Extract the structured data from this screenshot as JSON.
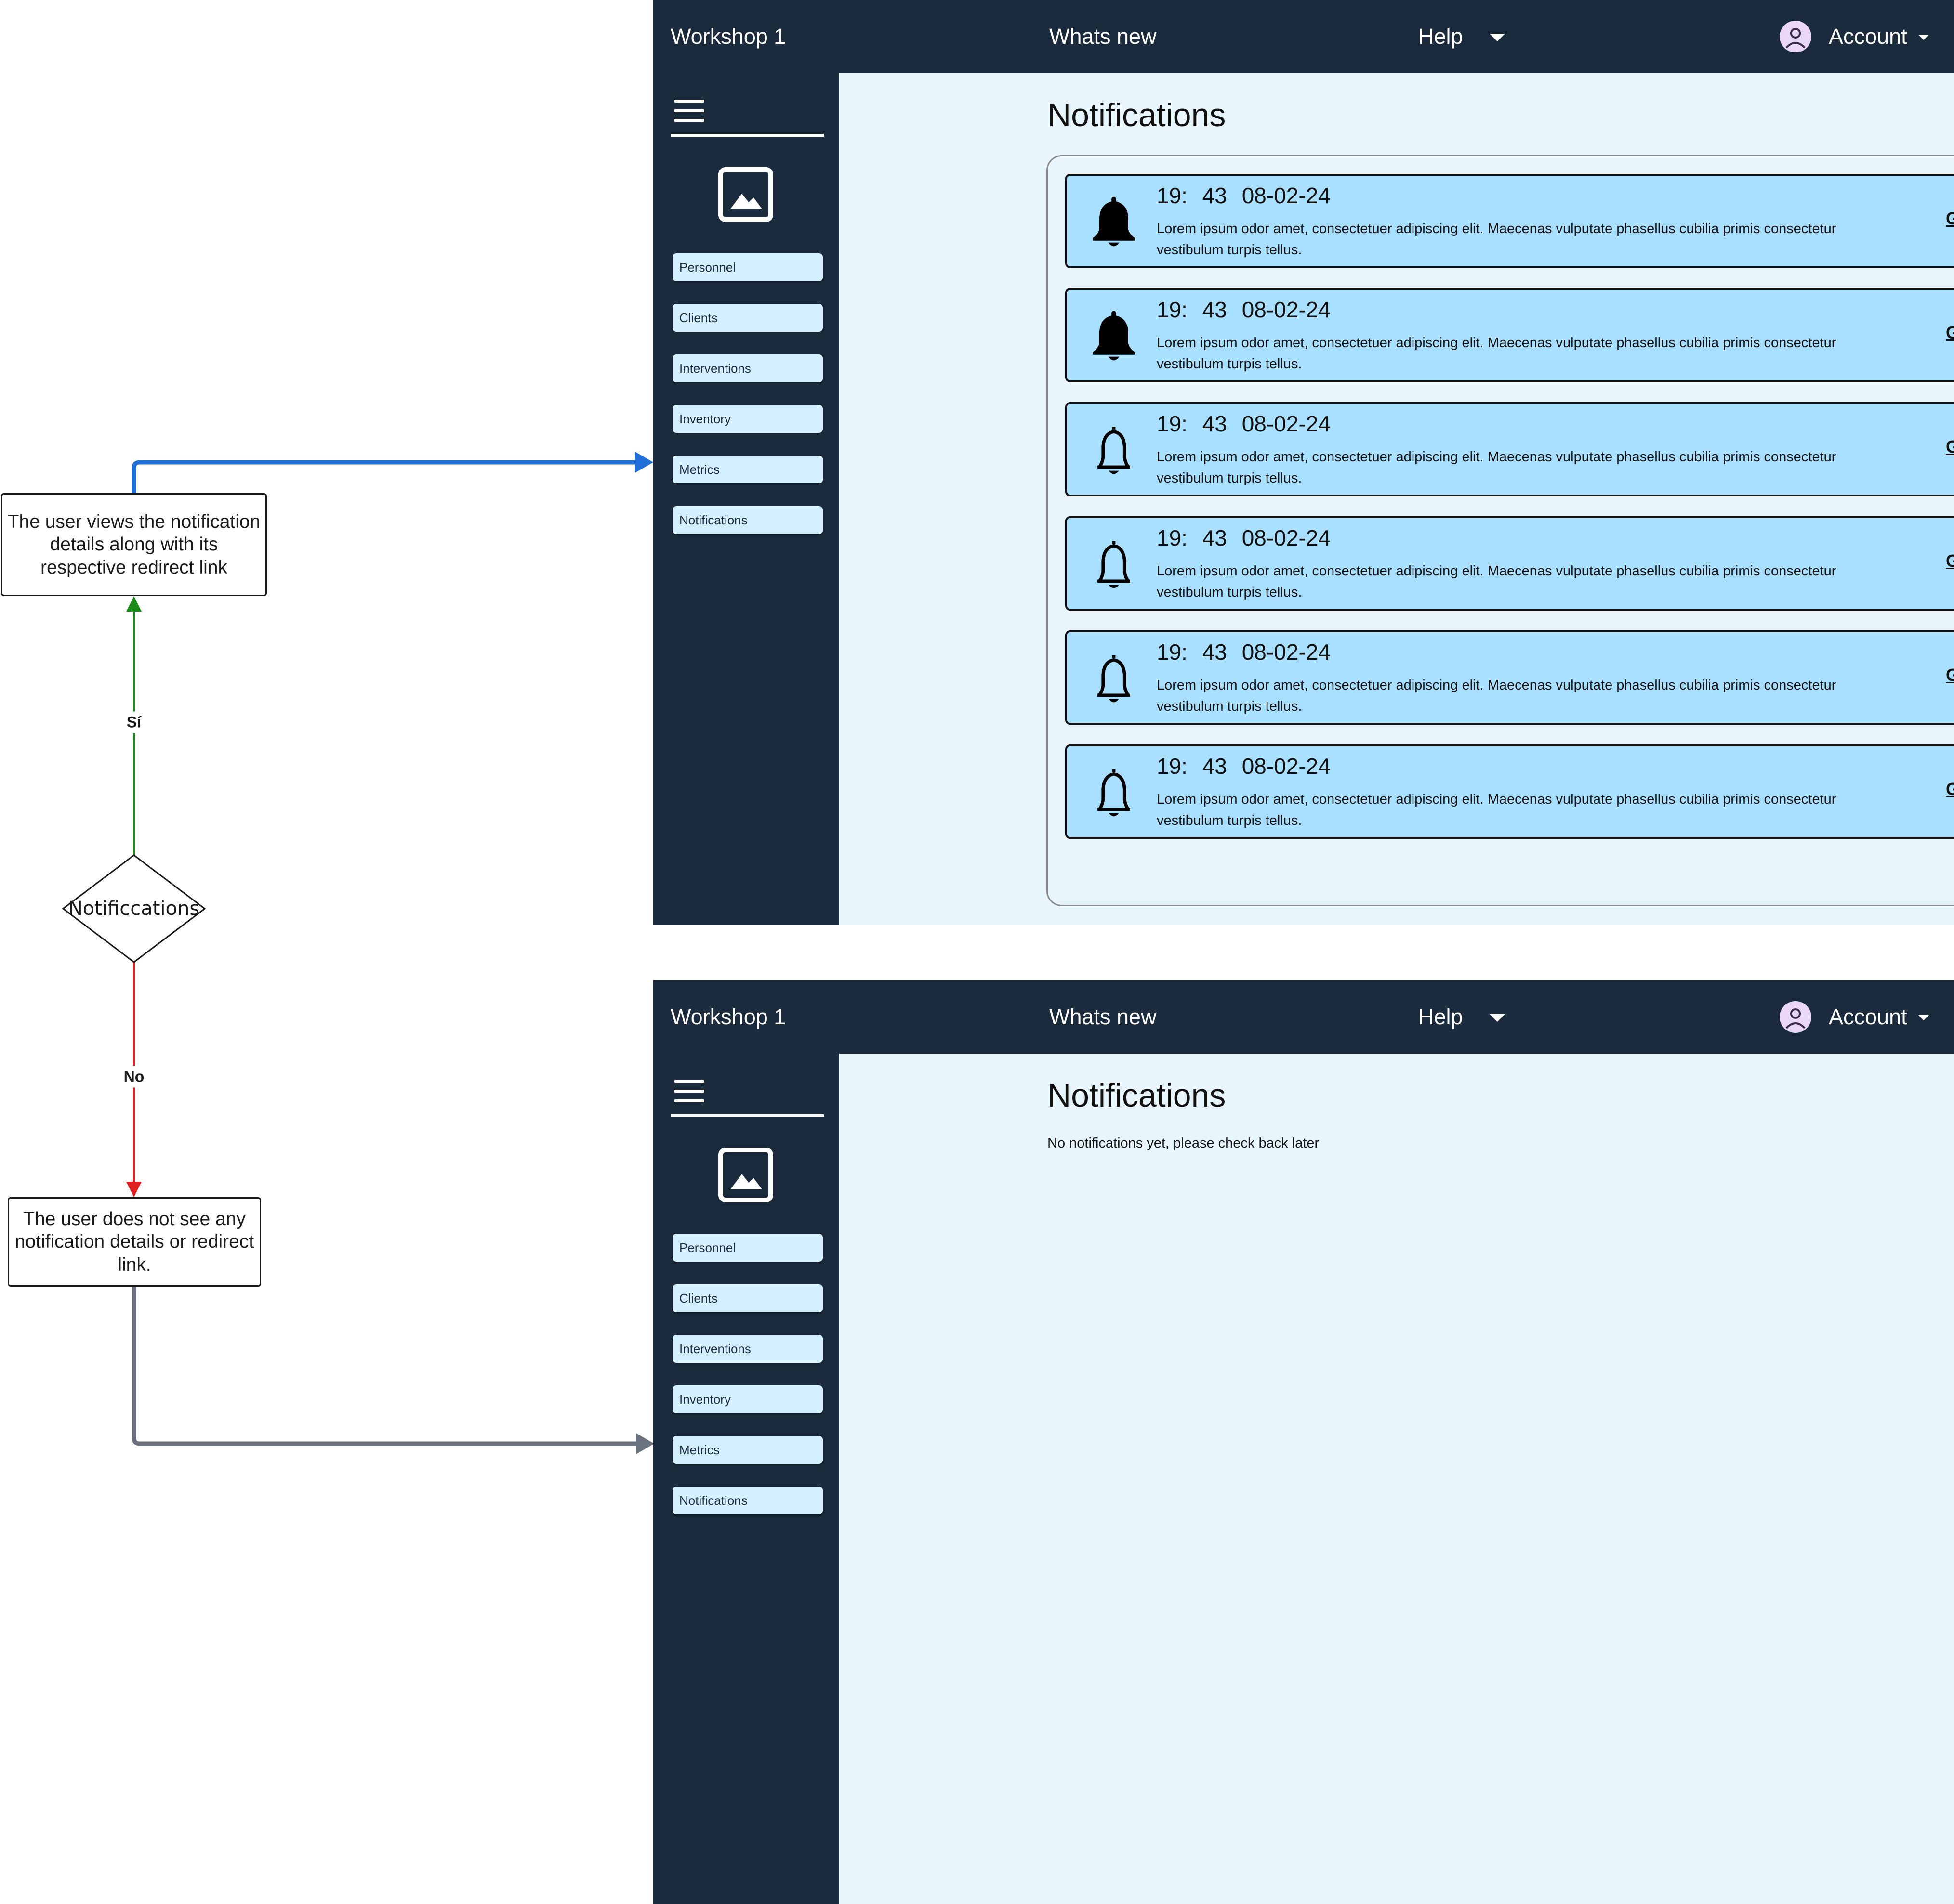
{
  "flowchart": {
    "decision": "Notificcations",
    "yes_label": "Sí",
    "no_label": "No",
    "yes_result": "The user views the notification details along with its respective redirect link",
    "no_result": "The user does not see any notification details or redirect link.",
    "colors": {
      "yes": "#1a8a1a",
      "no": "#e02020",
      "to_screen_yes": "#1f6fd6",
      "to_screen_no": "#6b7380"
    }
  },
  "screen_with_notifications": {
    "topbar": {
      "title": "Workshop 1",
      "whats_new": "Whats new",
      "help": "Help",
      "account": "Account"
    },
    "sidebar": {
      "items": [
        "Personnel",
        "Clients",
        "Interventions",
        "Inventory",
        "Metrics",
        "Notifications"
      ]
    },
    "page_title": "Notifications",
    "notifications": [
      {
        "time": "19: 43",
        "date": "08-02-24",
        "bell": "filled",
        "body": "Lorem ipsum odor amet, consectetuer adipiscing elit. Maecenas vulputate phasellus cubilia primis consectetur vestibulum turpis tellus.",
        "link": "Go to the section"
      },
      {
        "time": "19: 43",
        "date": "08-02-24",
        "bell": "filled",
        "body": "Lorem ipsum odor amet, consectetuer adipiscing elit. Maecenas vulputate phasellus cubilia primis consectetur vestibulum turpis tellus.",
        "link": "Go to the section"
      },
      {
        "time": "19: 43",
        "date": "08-02-24",
        "bell": "outline",
        "body": "Lorem ipsum odor amet, consectetuer adipiscing elit. Maecenas vulputate phasellus cubilia primis consectetur vestibulum turpis tellus.",
        "link": "Go to the section"
      },
      {
        "time": "19: 43",
        "date": "08-02-24",
        "bell": "outline",
        "body": "Lorem ipsum odor amet, consectetuer adipiscing elit. Maecenas vulputate phasellus cubilia primis consectetur vestibulum turpis tellus.",
        "link": "Go to the section"
      },
      {
        "time": "19: 43",
        "date": "08-02-24",
        "bell": "outline",
        "body": "Lorem ipsum odor amet, consectetuer adipiscing elit. Maecenas vulputate phasellus cubilia primis consectetur vestibulum turpis tellus.",
        "link": "Go to the section"
      },
      {
        "time": "19: 43",
        "date": "08-02-24",
        "bell": "outline",
        "body": "Lorem ipsum odor amet, consectetuer adipiscing elit. Maecenas vulputate phasellus cubilia primis consectetur vestibulum turpis tellus.",
        "link": "Go to the section"
      }
    ]
  },
  "screen_empty": {
    "topbar": {
      "title": "Workshop 1",
      "whats_new": "Whats new",
      "help": "Help",
      "account": "Account"
    },
    "sidebar": {
      "items": [
        "Personnel",
        "Clients",
        "Interventions",
        "Inventory",
        "Metrics",
        "Notifications"
      ]
    },
    "page_title": "Notifications",
    "empty_message": "No notifications yet, please check back later"
  },
  "theme": {
    "sidebar_bg": "#1b2a3c",
    "content_bg": "#e8f5fd",
    "card_bg": "#a9e0ff",
    "nav_button_bg": "#d4efff"
  }
}
